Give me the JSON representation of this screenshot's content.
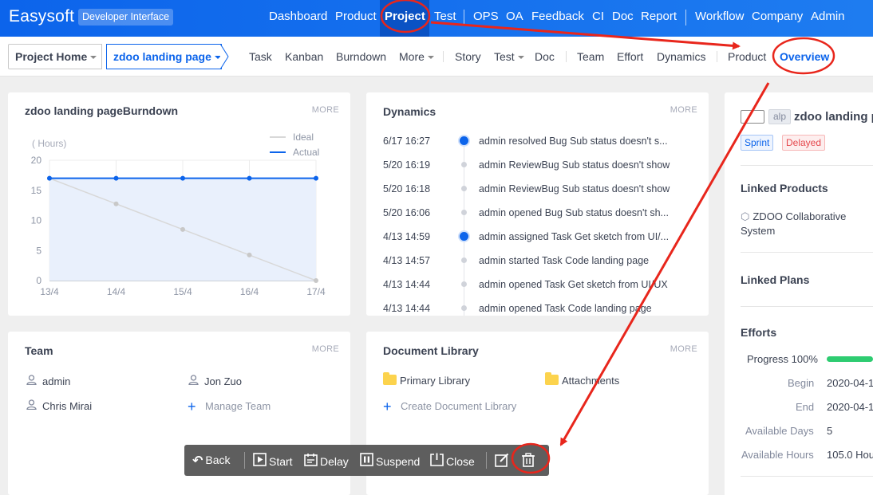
{
  "topbar": {
    "brand": "Easysoft",
    "badge": "Developer Interface",
    "nav": [
      "Dashboard",
      "Product",
      "Project",
      "Test",
      "OPS",
      "OA",
      "Feedback",
      "CI",
      "Doc",
      "Report",
      "Workflow",
      "Company",
      "Admin"
    ],
    "active": "Project"
  },
  "subnav": {
    "crumb_home": "Project Home",
    "crumb_project": "zdoo landing page",
    "items": [
      "Task",
      "Kanban",
      "Burndown",
      "More",
      "Story",
      "Test",
      "Doc",
      "Team",
      "Effort",
      "Dynamics",
      "Product",
      "Overview"
    ],
    "active": "Overview"
  },
  "burndown": {
    "title": "zdoo landing pageBurndown",
    "more": "MORE",
    "chart_data": {
      "type": "line",
      "ylabel": "( Hours)",
      "categories": [
        "13/4",
        "14/4",
        "15/4",
        "16/4",
        "17/4"
      ],
      "yticks": [
        0,
        5,
        10,
        15,
        20
      ],
      "ylim": [
        0,
        20
      ],
      "legend": "top-right",
      "series": [
        {
          "name": "Ideal",
          "values": [
            17,
            12.75,
            8.5,
            4.25,
            0
          ],
          "color": "#d8d8d8"
        },
        {
          "name": "Actual",
          "values": [
            17,
            17,
            17,
            17,
            17
          ],
          "color": "#0c64eb"
        }
      ]
    }
  },
  "dynamics": {
    "title": "Dynamics",
    "more": "MORE",
    "items": [
      {
        "time": "6/17 16:27",
        "text": "admin resolved Bug Sub status doesn't s...",
        "highlight": true
      },
      {
        "time": "5/20 16:19",
        "text": "admin ReviewBug Sub status doesn't show",
        "highlight": false
      },
      {
        "time": "5/20 16:18",
        "text": "admin ReviewBug Sub status doesn't show",
        "highlight": false
      },
      {
        "time": "5/20 16:06",
        "text": "admin opened Bug Sub status doesn't sh...",
        "highlight": false
      },
      {
        "time": "4/13 14:59",
        "text": "admin assigned Task Get sketch from UI/...",
        "highlight": true
      },
      {
        "time": "4/13 14:57",
        "text": "admin started Task Code landing page",
        "highlight": false
      },
      {
        "time": "4/13 14:44",
        "text": "admin opened Task Get sketch from UI/UX",
        "highlight": false
      },
      {
        "time": "4/13 14:44",
        "text": "admin opened Task Code landing page",
        "highlight": false
      }
    ]
  },
  "team": {
    "title": "Team",
    "more": "MORE",
    "members": [
      "admin",
      "Jon Zuo",
      "Chris Mirai"
    ],
    "manage": "Manage Team"
  },
  "doclib": {
    "title": "Document Library",
    "more": "MORE",
    "libs": [
      "Primary Library",
      "Attachments"
    ],
    "create": "Create Document Library"
  },
  "project_info": {
    "alp": "alp",
    "name": "zdoo landing p",
    "tag_type": "Sprint",
    "tag_status": "Delayed",
    "linked_products_title": "Linked Products",
    "linked_product": "ZDOO Collaborative System",
    "linked_plans_title": "Linked Plans",
    "efforts_title": "Efforts",
    "progress_label": "Progress 100%",
    "progress": 1.0,
    "begin_label": "Begin",
    "begin_value": "2020-04-1",
    "end_label": "End",
    "end_value": "2020-04-1",
    "days_label": "Available Days",
    "days_value": "5",
    "hours_label": "Available Hours",
    "hours_value": "105.0 Hou"
  },
  "toolbar": {
    "back": "Back",
    "start": "Start",
    "delay": "Delay",
    "suspend": "Suspend",
    "close": "Close"
  },
  "colors": {
    "primary": "#0c64eb",
    "annotation": "#e8261c"
  }
}
